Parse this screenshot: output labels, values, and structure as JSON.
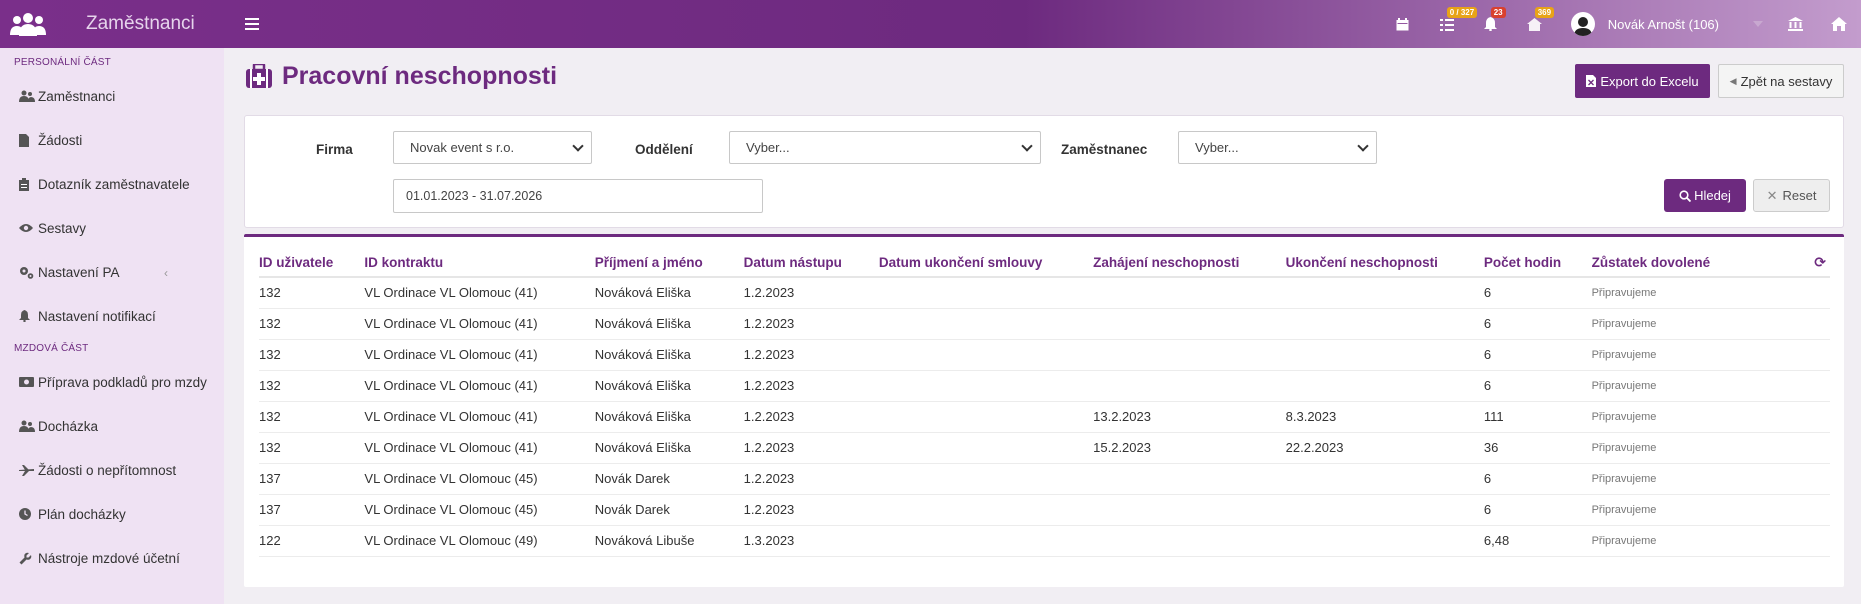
{
  "app": {
    "title": "Zaměstnanci"
  },
  "topbar": {
    "tasks_badge": "0 / 327",
    "notifications_badge": "23",
    "messages_badge": "369",
    "user_name": "Novák Arnošt (106)"
  },
  "sidebar": {
    "section_personal": "PERSONÁLNÍ ČÁST",
    "section_payroll": "MZDOVÁ ČÁST",
    "items_personal": [
      {
        "label": "Zaměstnanci",
        "icon": "users-icon"
      },
      {
        "label": "Žádosti",
        "icon": "file-icon"
      },
      {
        "label": "Dotazník zaměstnavatele",
        "icon": "clipboard-icon"
      },
      {
        "label": "Sestavy",
        "icon": "eye-icon"
      },
      {
        "label": "Nastavení PA",
        "icon": "gears-icon"
      },
      {
        "label": "Nastavení notifikací",
        "icon": "bell-icon"
      }
    ],
    "items_payroll": [
      {
        "label": "Příprava podkladů pro mzdy",
        "icon": "money-icon"
      },
      {
        "label": "Docházka",
        "icon": "users-icon"
      },
      {
        "label": "Žádosti o nepřítomnost",
        "icon": "plane-icon"
      },
      {
        "label": "Plán docházky",
        "icon": "clock-icon"
      },
      {
        "label": "Nástroje mzdové účetní",
        "icon": "wrench-icon"
      }
    ]
  },
  "page": {
    "title": "Pracovní neschopnosti",
    "export_label": "Export do Excelu",
    "back_label": "Zpět na sestavy"
  },
  "filters": {
    "firma_label": "Firma",
    "firma_value": "Novak event s r.o.",
    "oddeleni_label": "Oddělení",
    "oddeleni_value": "Vyber...",
    "zamestnanec_label": "Zaměstnanec",
    "zamestnanec_value": "Vyber...",
    "date_range": "01.01.2023 - 31.07.2026",
    "search_label": "Hledej",
    "reset_label": "Reset"
  },
  "table": {
    "columns": [
      "ID uživatele",
      "ID kontraktu",
      "Příjmení a jméno",
      "Datum nástupu",
      "Datum ukončení smlouvy",
      "Zahájení neschopnosti",
      "Ukončení neschopnosti",
      "Počet hodin",
      "Zůstatek dovolené"
    ],
    "rows": [
      [
        "132",
        "VL Ordinace VL Olomouc (41)",
        "Nováková Eliška",
        "1.2.2023",
        "",
        "",
        "",
        "6",
        "Připravujeme"
      ],
      [
        "132",
        "VL Ordinace VL Olomouc (41)",
        "Nováková Eliška",
        "1.2.2023",
        "",
        "",
        "",
        "6",
        "Připravujeme"
      ],
      [
        "132",
        "VL Ordinace VL Olomouc (41)",
        "Nováková Eliška",
        "1.2.2023",
        "",
        "",
        "",
        "6",
        "Připravujeme"
      ],
      [
        "132",
        "VL Ordinace VL Olomouc (41)",
        "Nováková Eliška",
        "1.2.2023",
        "",
        "",
        "",
        "6",
        "Připravujeme"
      ],
      [
        "132",
        "VL Ordinace VL Olomouc (41)",
        "Nováková Eliška",
        "1.2.2023",
        "",
        "13.2.2023",
        "8.3.2023",
        "111",
        "Připravujeme"
      ],
      [
        "132",
        "VL Ordinace VL Olomouc (41)",
        "Nováková Eliška",
        "1.2.2023",
        "",
        "15.2.2023",
        "22.2.2023",
        "36",
        "Připravujeme"
      ],
      [
        "137",
        "VL Ordinace VL Olomouc (45)",
        "Novák Darek",
        "1.2.2023",
        "",
        "",
        "",
        "6",
        "Připravujeme"
      ],
      [
        "137",
        "VL Ordinace VL Olomouc (45)",
        "Novák Darek",
        "1.2.2023",
        "",
        "",
        "",
        "6",
        "Připravujeme"
      ],
      [
        "122",
        "VL Ordinace VL Olomouc (49)",
        "Nováková Libuše",
        "1.3.2023",
        "",
        "",
        "",
        "6,48",
        "Připravujeme"
      ]
    ]
  },
  "colors": {
    "brand": "#6d2a7f",
    "sidebar_bg": "#efe2f3",
    "badge_orange": "#e8a317",
    "badge_red": "#d9412f"
  }
}
